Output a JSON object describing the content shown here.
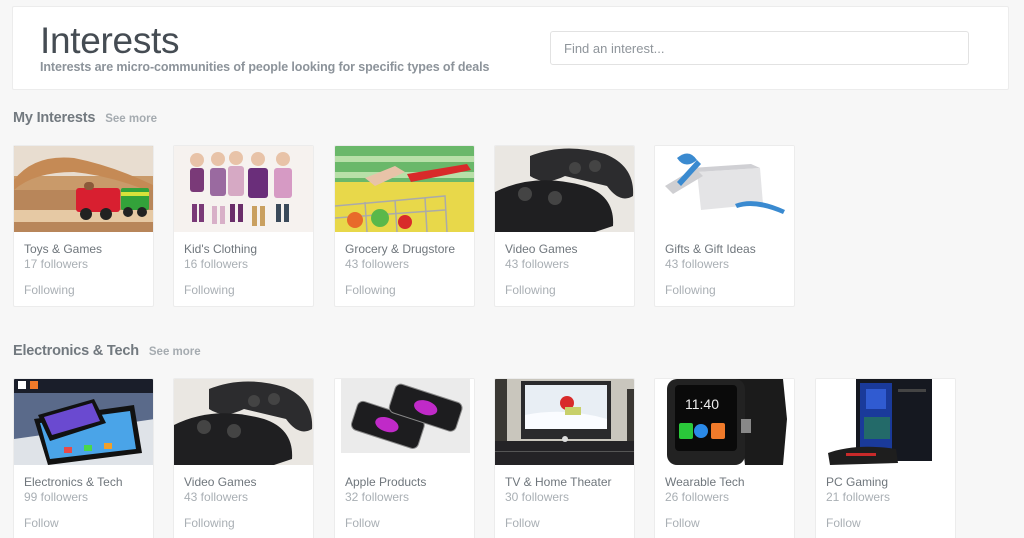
{
  "header": {
    "title": "Interests",
    "subtitle": "Interests are micro-communities of people looking for specific types of deals",
    "search_placeholder": "Find an interest..."
  },
  "sections": [
    {
      "title": "My Interests",
      "see_more": "See more",
      "cards": [
        {
          "name": "Toys & Games",
          "followers": "17 followers",
          "action": "Following",
          "image": "toy-train-image"
        },
        {
          "name": "Kid's Clothing",
          "followers": "16 followers",
          "action": "Following",
          "image": "kids-clothing-image"
        },
        {
          "name": "Grocery & Drugstore",
          "followers": "43 followers",
          "action": "Following",
          "image": "grocery-cart-image"
        },
        {
          "name": "Video Games",
          "followers": "43 followers",
          "action": "Following",
          "image": "game-controller-image"
        },
        {
          "name": "Gifts & Gift Ideas",
          "followers": "43 followers",
          "action": "Following",
          "image": "gift-box-image"
        }
      ]
    },
    {
      "title": "Electronics & Tech",
      "see_more": "See more",
      "cards": [
        {
          "name": "Electronics & Tech",
          "followers": "99 followers",
          "action": "Follow",
          "image": "tablet-phone-image"
        },
        {
          "name": "Video Games",
          "followers": "43 followers",
          "action": "Following",
          "image": "game-controller-image"
        },
        {
          "name": "Apple Products",
          "followers": "32 followers",
          "action": "Follow",
          "image": "iphones-image"
        },
        {
          "name": "TV & Home Theater",
          "followers": "30 followers",
          "action": "Follow",
          "image": "tv-image"
        },
        {
          "name": "Wearable Tech",
          "followers": "26 followers",
          "action": "Follow",
          "image": "smartwatch-image"
        },
        {
          "name": "PC Gaming",
          "followers": "21 followers",
          "action": "Follow",
          "image": "gaming-pc-image"
        }
      ]
    }
  ]
}
